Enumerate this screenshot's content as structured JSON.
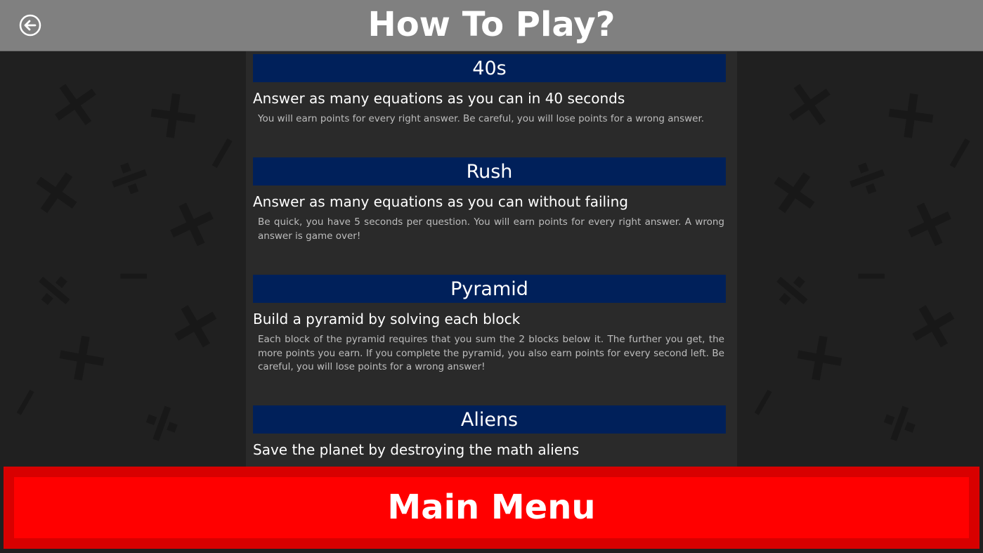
{
  "header": {
    "title": "How To Play?",
    "back_icon": "back-arrow-icon"
  },
  "modes": [
    {
      "name": "40s",
      "subtitle": "Answer as many equations as you can in 40 seconds",
      "description": "You will earn points for every right answer. Be careful, you will lose points for a wrong answer."
    },
    {
      "name": "Rush",
      "subtitle": "Answer as many equations as you can without failing",
      "description": "Be quick, you have 5 seconds per question. You will earn points for every right answer. A wrong answer is game over!"
    },
    {
      "name": "Pyramid",
      "subtitle": "Build a pyramid by solving each block",
      "description": "Each block of the pyramid requires that you sum the 2 blocks below it. The further you get, the more points you earn. If you complete the pyramid, you also earn points for every second left. Be careful, you will lose points for a wrong answer!"
    },
    {
      "name": "Aliens",
      "subtitle": "Save the planet by destroying the math aliens",
      "description": ""
    }
  ],
  "footer": {
    "main_menu_label": "Main Menu"
  },
  "colors": {
    "header_bg": "#808080",
    "page_bg": "#202020",
    "content_bg": "#2a2a2a",
    "mode_header_bg": "#00205a",
    "button_outer": "#d80000",
    "button_inner": "#ff0000"
  }
}
